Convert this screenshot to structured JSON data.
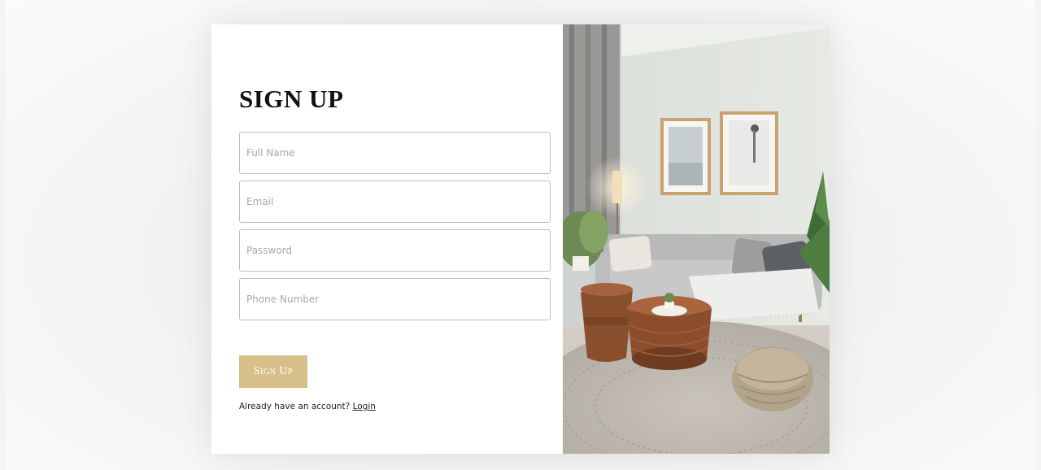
{
  "signup": {
    "title": "SIGN UP",
    "fields": {
      "full_name": {
        "placeholder": "Full Name",
        "value": ""
      },
      "email": {
        "placeholder": "Email",
        "value": ""
      },
      "password": {
        "placeholder": "Password",
        "value": ""
      },
      "phone": {
        "placeholder": "Phone Number",
        "value": ""
      }
    },
    "submit_label": "Sign Up",
    "login_prompt": "Already have an account?",
    "login_link": "Login"
  },
  "colors": {
    "accent": "#d6bf8a",
    "card_bg": "#ffffff",
    "page_bg": "#f4f4f4"
  },
  "image": {
    "subject": "living-room-interior-photo"
  }
}
